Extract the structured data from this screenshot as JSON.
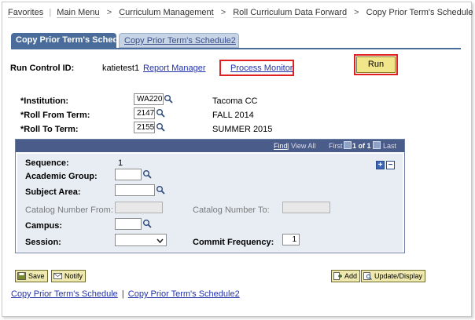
{
  "breadcrumb": {
    "items": [
      "Favorites",
      "Main Menu",
      "Curriculum Management",
      "Roll Curriculum Data Forward",
      "Copy Prior Term's Schedule"
    ],
    "separator": ">"
  },
  "tabs": {
    "active": "Copy Prior Term's Schedule",
    "inactive": "Copy Prior Term's Schedule2"
  },
  "run_control": {
    "label": "Run Control ID:",
    "value": "katietest1",
    "report_manager": "Report Manager",
    "process_monitor": "Process Monitor",
    "run_label": "Run"
  },
  "fields": {
    "institution": {
      "label": "*Institution:",
      "value": "WA220",
      "desc": "Tacoma CC"
    },
    "roll_from": {
      "label": "*Roll From Term:",
      "value": "2147",
      "desc": "FALL 2014"
    },
    "roll_to": {
      "label": "*Roll To Term:",
      "value": "2155",
      "desc": "SUMMER 2015"
    }
  },
  "grid": {
    "find": "Find",
    "separator": "|",
    "view_all": "View All",
    "first": "First",
    "count": "1 of 1",
    "last": "Last",
    "sequence_label": "Sequence:",
    "sequence_value": "1",
    "academic_group": "Academic Group:",
    "subject_area": "Subject Area:",
    "catalog_from": "Catalog Number From:",
    "catalog_to": "Catalog Number To:",
    "campus": "Campus:",
    "session": "Session:",
    "commit_frequency": "Commit Frequency:",
    "commit_value": "1",
    "add_symbol": "+",
    "remove_symbol": "−"
  },
  "buttons": {
    "save": "Save",
    "notify": "Notify",
    "add": "Add",
    "update_display": "Update/Display"
  },
  "footer": {
    "link1": "Copy Prior Term's Schedule",
    "separator": "|",
    "link2": "Copy Prior Term's Schedule2"
  },
  "colors": {
    "highlight": "#e02020",
    "tab_active": "#4a6c9a",
    "grid_header": "#4a5d8a",
    "run_button": "#f2e68a"
  }
}
